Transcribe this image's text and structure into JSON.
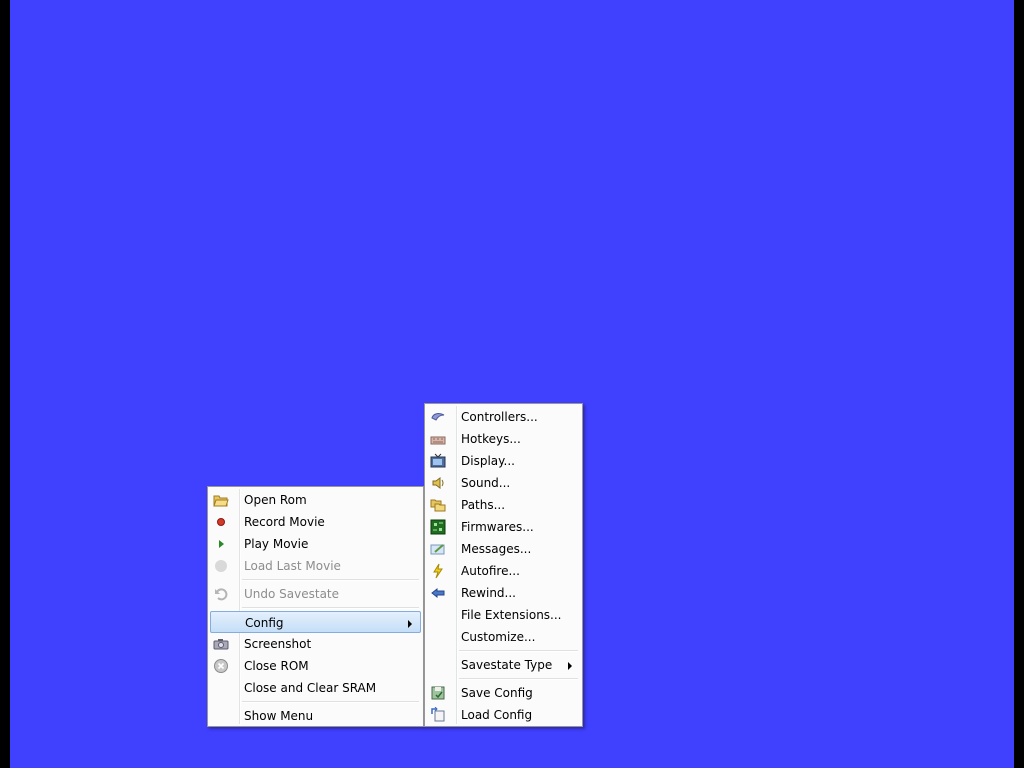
{
  "context_menu": {
    "items": [
      {
        "label": "Open Rom",
        "icon": "folder-open-icon",
        "disabled": false
      },
      {
        "label": "Record Movie",
        "icon": "record-icon",
        "disabled": false
      },
      {
        "label": "Play Movie",
        "icon": "play-icon",
        "disabled": false
      },
      {
        "label": "Load Last Movie",
        "icon": "disabled-circle-icon",
        "disabled": true
      },
      {
        "label": "Undo Savestate",
        "icon": "undo-icon",
        "disabled": true
      },
      {
        "label": "Config",
        "icon": "",
        "disabled": false,
        "selected": true,
        "has_submenu": true
      },
      {
        "label": "Screenshot",
        "icon": "camera-icon",
        "disabled": false
      },
      {
        "label": "Close ROM",
        "icon": "close-circle-icon",
        "disabled": false
      },
      {
        "label": "Close and Clear SRAM",
        "icon": "",
        "disabled": false
      },
      {
        "label": "Show Menu",
        "icon": "",
        "disabled": false
      }
    ]
  },
  "config_submenu": {
    "items": [
      {
        "label": "Controllers...",
        "icon": "gamepad-icon"
      },
      {
        "label": "Hotkeys...",
        "icon": "keyboard-icon"
      },
      {
        "label": "Display...",
        "icon": "tv-icon"
      },
      {
        "label": "Sound...",
        "icon": "speaker-icon"
      },
      {
        "label": "Paths...",
        "icon": "folders-icon"
      },
      {
        "label": "Firmwares...",
        "icon": "chip-icon"
      },
      {
        "label": "Messages...",
        "icon": "message-icon"
      },
      {
        "label": "Autofire...",
        "icon": "lightning-icon"
      },
      {
        "label": "Rewind...",
        "icon": "rewind-arrow-icon"
      },
      {
        "label": "File Extensions...",
        "icon": ""
      },
      {
        "label": "Customize...",
        "icon": ""
      },
      {
        "label": "Savestate Type",
        "icon": "",
        "has_submenu": true
      },
      {
        "label": "Save Config",
        "icon": "save-config-icon"
      },
      {
        "label": "Load Config",
        "icon": "load-config-icon"
      }
    ]
  },
  "colors": {
    "desktop_background": "#4040ff",
    "menu_background": "#fbfbfb",
    "selection_highlight": "#c5dff8"
  }
}
